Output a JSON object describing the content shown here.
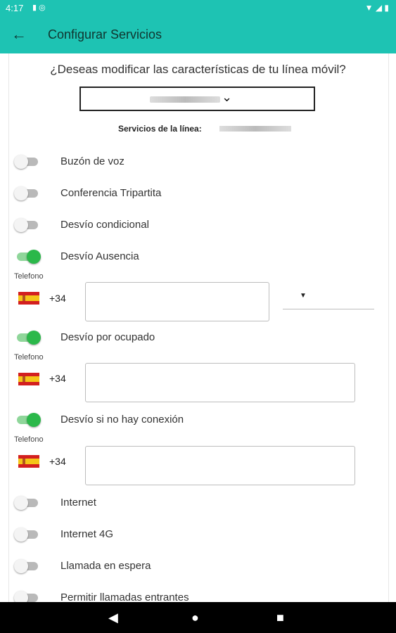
{
  "status": {
    "time": "4:17",
    "left_icons": [
      "sd-card-icon",
      "sync-icon"
    ],
    "right_icons": [
      "wifi-icon",
      "signal-icon",
      "battery-icon"
    ]
  },
  "appbar": {
    "title": "Configurar Servicios"
  },
  "question": "¿Deseas modificar las características de tu línea móvil?",
  "line_select": {
    "value": ""
  },
  "services_label": "Servicios de la línea:",
  "services": [
    {
      "label": "Buzón de voz",
      "on": false
    },
    {
      "label": "Conferencia Tripartita",
      "on": false
    },
    {
      "label": "Desvío condicional",
      "on": false
    },
    {
      "label": "Desvío Ausencia",
      "on": true
    },
    {
      "label": "Desvío por ocupado",
      "on": true
    },
    {
      "label": "Desvío si no hay conexión",
      "on": true
    },
    {
      "label": "Internet",
      "on": false
    },
    {
      "label": "Internet 4G",
      "on": false
    },
    {
      "label": "Llamada en espera",
      "on": false
    },
    {
      "label": "Permitir llamadas entrantes",
      "on": false
    }
  ],
  "phone_fields": [
    {
      "label": "Telefono",
      "country_code": "+34",
      "value": ""
    },
    {
      "label": "Telefono",
      "country_code": "+34",
      "value": ""
    },
    {
      "label": "Telefono",
      "country_code": "+34",
      "value": ""
    }
  ],
  "colors": {
    "accent": "#1ec3b3",
    "toggle_on": "#2bb84a"
  }
}
